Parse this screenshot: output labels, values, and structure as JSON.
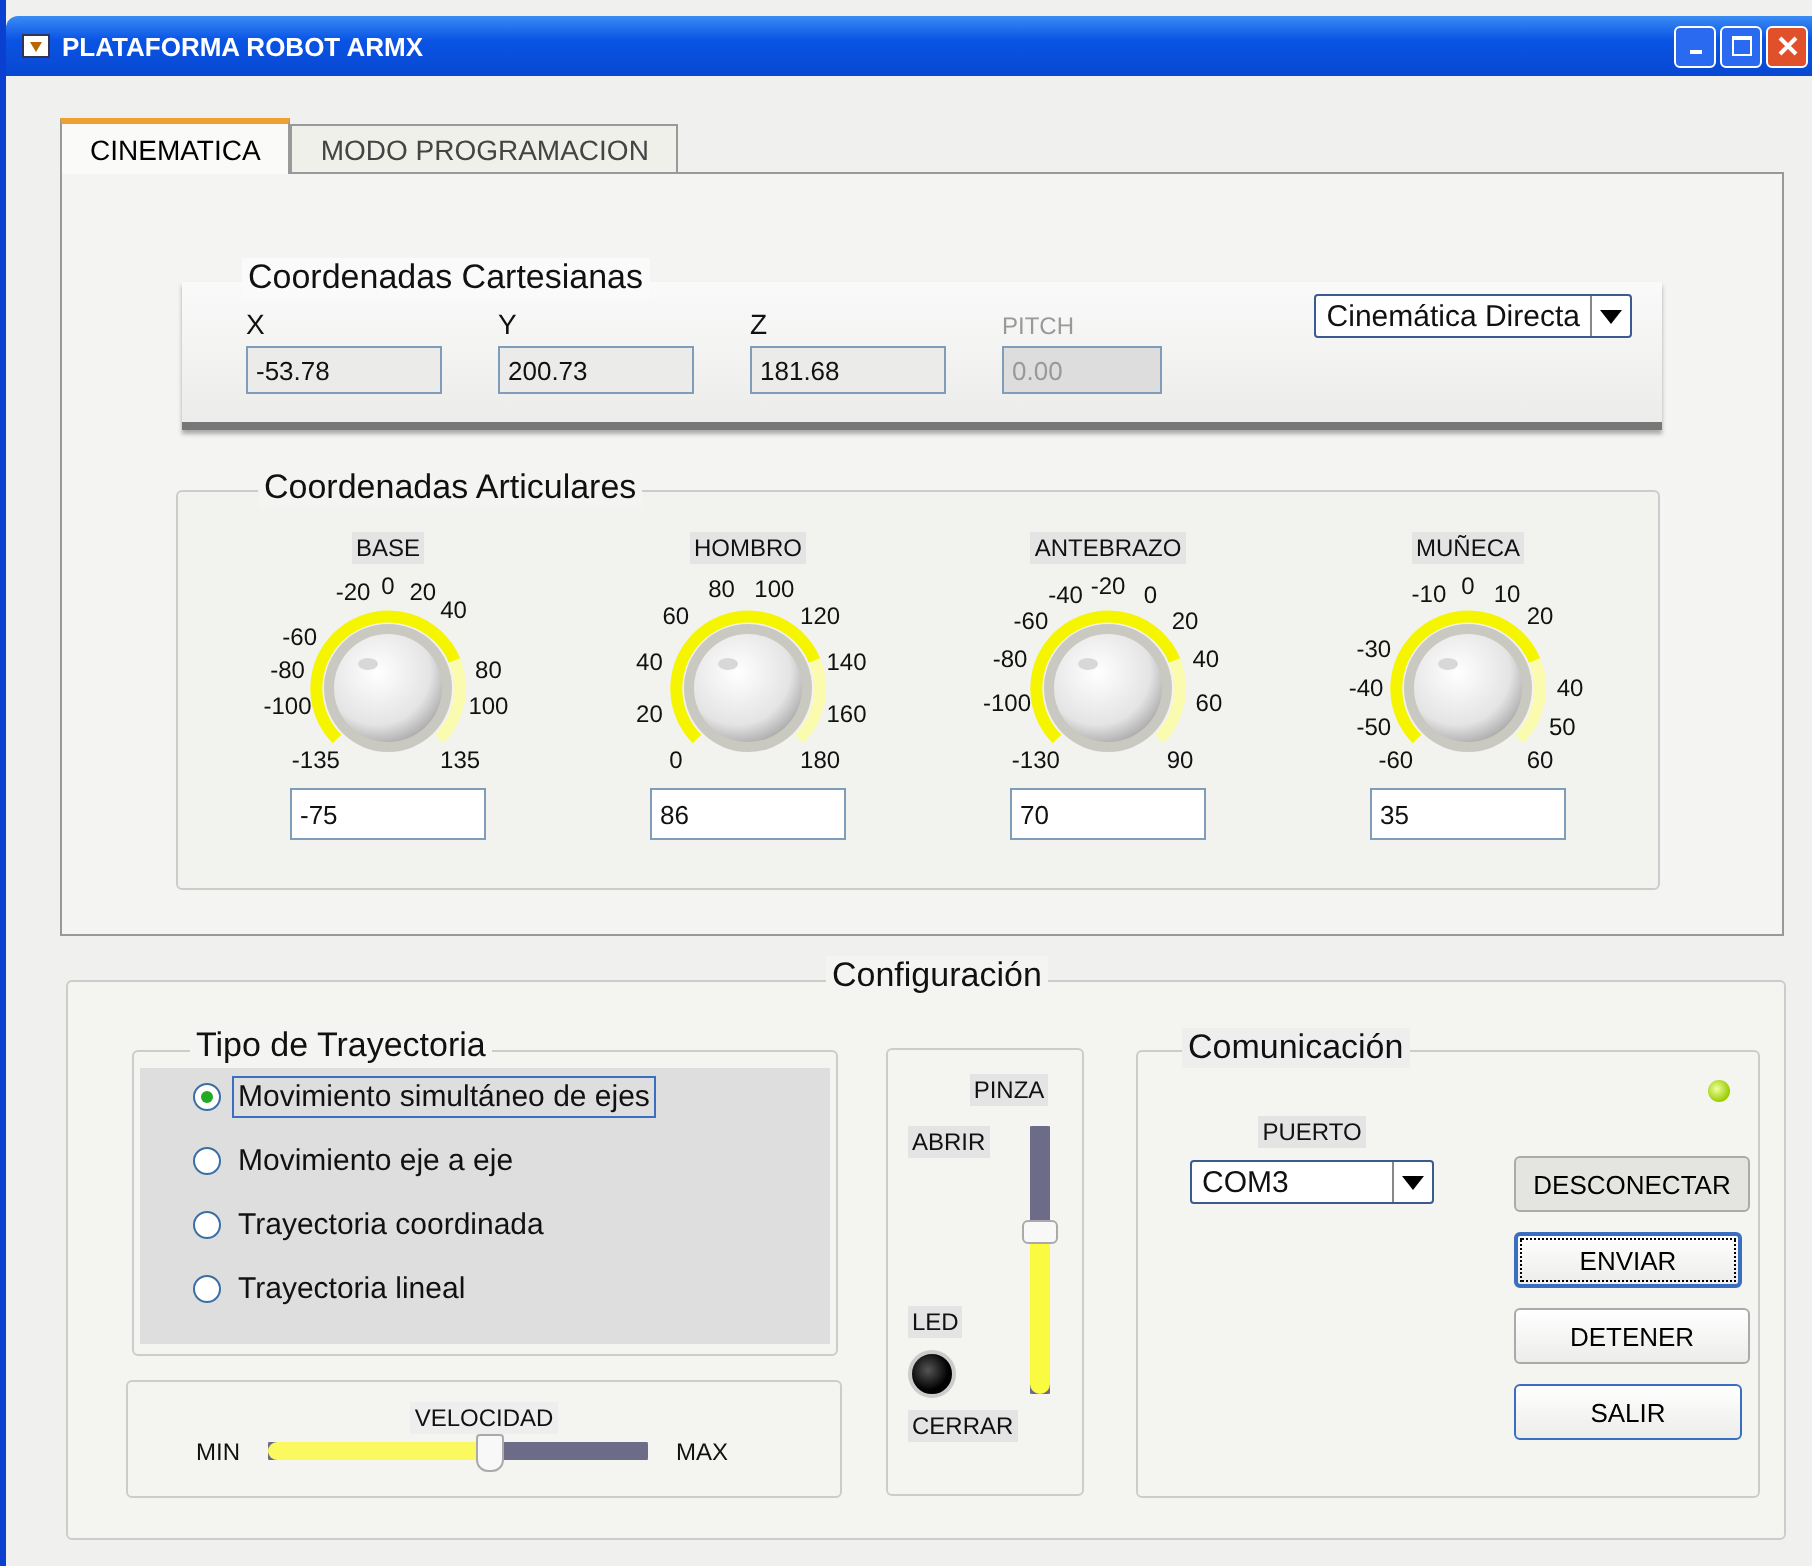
{
  "window": {
    "title": "PLATAFORMA ROBOT ARMX"
  },
  "tabs": [
    {
      "label": "CINEMATICA",
      "selected": true
    },
    {
      "label": "MODO PROGRAMACION",
      "selected": false
    }
  ],
  "cartesian": {
    "title": "Coordenadas Cartesianas",
    "fields": [
      {
        "label": "X",
        "value": "-53.78",
        "disabled": false
      },
      {
        "label": "Y",
        "value": "200.73",
        "disabled": false
      },
      {
        "label": "Z",
        "value": "181.68",
        "disabled": false
      },
      {
        "label": "PITCH",
        "value": "0.00",
        "disabled": true
      }
    ],
    "mode": "Cinemática Directa"
  },
  "articular": {
    "title": "Coordenadas Articulares",
    "joints": [
      {
        "name": "BASE",
        "ticks": [
          "-20",
          "0",
          "20",
          "40",
          "-60",
          "-80",
          "80",
          "-100",
          "100",
          "-135",
          "135"
        ],
        "value": "-75"
      },
      {
        "name": "HOMBRO",
        "ticks": [
          "80",
          "100",
          "60",
          "120",
          "40",
          "140",
          "20",
          "160",
          "0",
          "180"
        ],
        "value": "86"
      },
      {
        "name": "ANTEBRAZO",
        "ticks": [
          "-40",
          "-20",
          "0",
          "-60",
          "20",
          "-80",
          "40",
          "-100",
          "60",
          "-130",
          "90"
        ],
        "value": "70"
      },
      {
        "name": "MUÑECA",
        "ticks": [
          "-10",
          "0",
          "10",
          "20",
          "-30",
          "-40",
          "40",
          "-50",
          "50",
          "-60",
          "60"
        ],
        "value": "35"
      }
    ]
  },
  "config": {
    "title": "Configuración",
    "trajectory": {
      "title": "Tipo de Trayectoria",
      "options": [
        {
          "label": "Movimiento simultáneo de ejes",
          "selected": true
        },
        {
          "label": "Movimiento eje a eje",
          "selected": false
        },
        {
          "label": "Trayectoria coordinada",
          "selected": false
        },
        {
          "label": "Trayectoria lineal",
          "selected": false
        }
      ]
    },
    "speed": {
      "label": "VELOCIDAD",
      "min_label": "MIN",
      "max_label": "MAX",
      "level": 0.58
    },
    "gripper": {
      "label": "PINZA",
      "open_label": "ABRIR",
      "close_label": "CERRAR",
      "led_label": "LED",
      "led_on": false,
      "level": 0.6
    },
    "communication": {
      "title": "Comunicación",
      "indicator_on": true,
      "port_label": "PUERTO",
      "port_value": "COM3",
      "buttons": [
        {
          "label": "DESCONECTAR",
          "pressed": true,
          "focused": false,
          "default": false
        },
        {
          "label": "ENVIAR",
          "pressed": false,
          "focused": true,
          "default": false
        },
        {
          "label": "DETENER",
          "pressed": false,
          "focused": false,
          "default": false
        },
        {
          "label": "SALIR",
          "pressed": false,
          "focused": false,
          "default": true
        }
      ]
    }
  }
}
